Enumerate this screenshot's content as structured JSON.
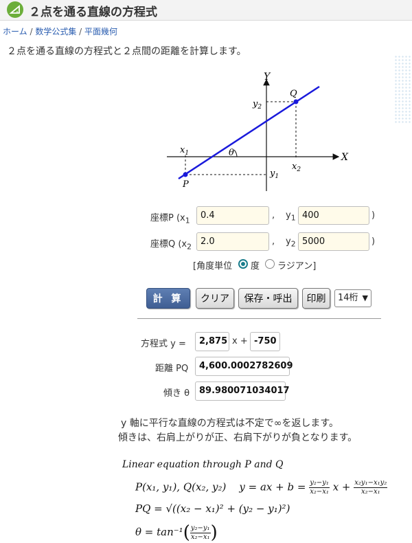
{
  "header": {
    "title": "２点を通る直線の方程式"
  },
  "breadcrumb": {
    "home": "ホーム",
    "sep1": " / ",
    "section": "数学公式集",
    "sep2": " / ",
    "current": "平面幾何"
  },
  "description": "２点を通る直線の方程式と２点間の距離を計算します。",
  "diagram": {
    "y_axis": "Y",
    "x_axis": "X",
    "q_label": "Q",
    "p_label": "P",
    "y2": "y",
    "y2_sub": "2",
    "x1": "x",
    "x1_sub": "1",
    "theta": "θ",
    "x2": "x",
    "x2_sub": "2",
    "y1": "y",
    "y1_sub": "1"
  },
  "form": {
    "p_label": "座標P (x",
    "p_x_sub": "1",
    "p_x_value": "0.4",
    "p_comma": ",",
    "p_y_label": "y",
    "p_y_sub": "1",
    "p_y_value": "400",
    "p_close": ")",
    "q_label": "座標Q (x",
    "q_x_sub": "2",
    "q_x_value": "2.0",
    "q_comma": ",",
    "q_y_label": "y",
    "q_y_sub": "2",
    "q_y_value": "5000",
    "q_close": ")",
    "angle_unit_label": "[角度単位",
    "degree_label": "度",
    "radian_label": "ラジアン]"
  },
  "buttons": {
    "calc": "計 算",
    "clear": "クリア",
    "save": "保存・呼出",
    "print": "印刷",
    "digits": "14桁"
  },
  "results": {
    "eq_label": "方程式 y =",
    "eq_a": "2,875",
    "eq_x": "x +",
    "eq_b": "-750",
    "dist_label": "距離 PQ",
    "dist_value": "4,600.0002782609",
    "angle_label": "傾き θ",
    "angle_value": "89.980071034017"
  },
  "notes": {
    "line1": "y 軸に平行な直線の方程式は不定で∞を返します。",
    "line2": "傾きは、右肩上がりが正、右肩下がりが負となります。"
  },
  "formulas": {
    "heading": "Linear equation through P and Q",
    "pq_points": "P(x₁, y₁), Q(x₂, y₂)",
    "line_eq_lhs": "y = ax + b =",
    "frac1_num": "y₂−y₁",
    "frac1_den": "x₂−x₁",
    "x_plus": "x +",
    "frac2_num": "x₂y₁−x₁y₂",
    "frac2_den": "x₂−x₁",
    "dist_eq": "PQ = √((x₂ − x₁)² + (y₂ − y₁)²)",
    "theta_lhs": "θ = tan⁻¹",
    "frac3_num": "y₂−y₁",
    "frac3_den": "x₂−x₁"
  }
}
